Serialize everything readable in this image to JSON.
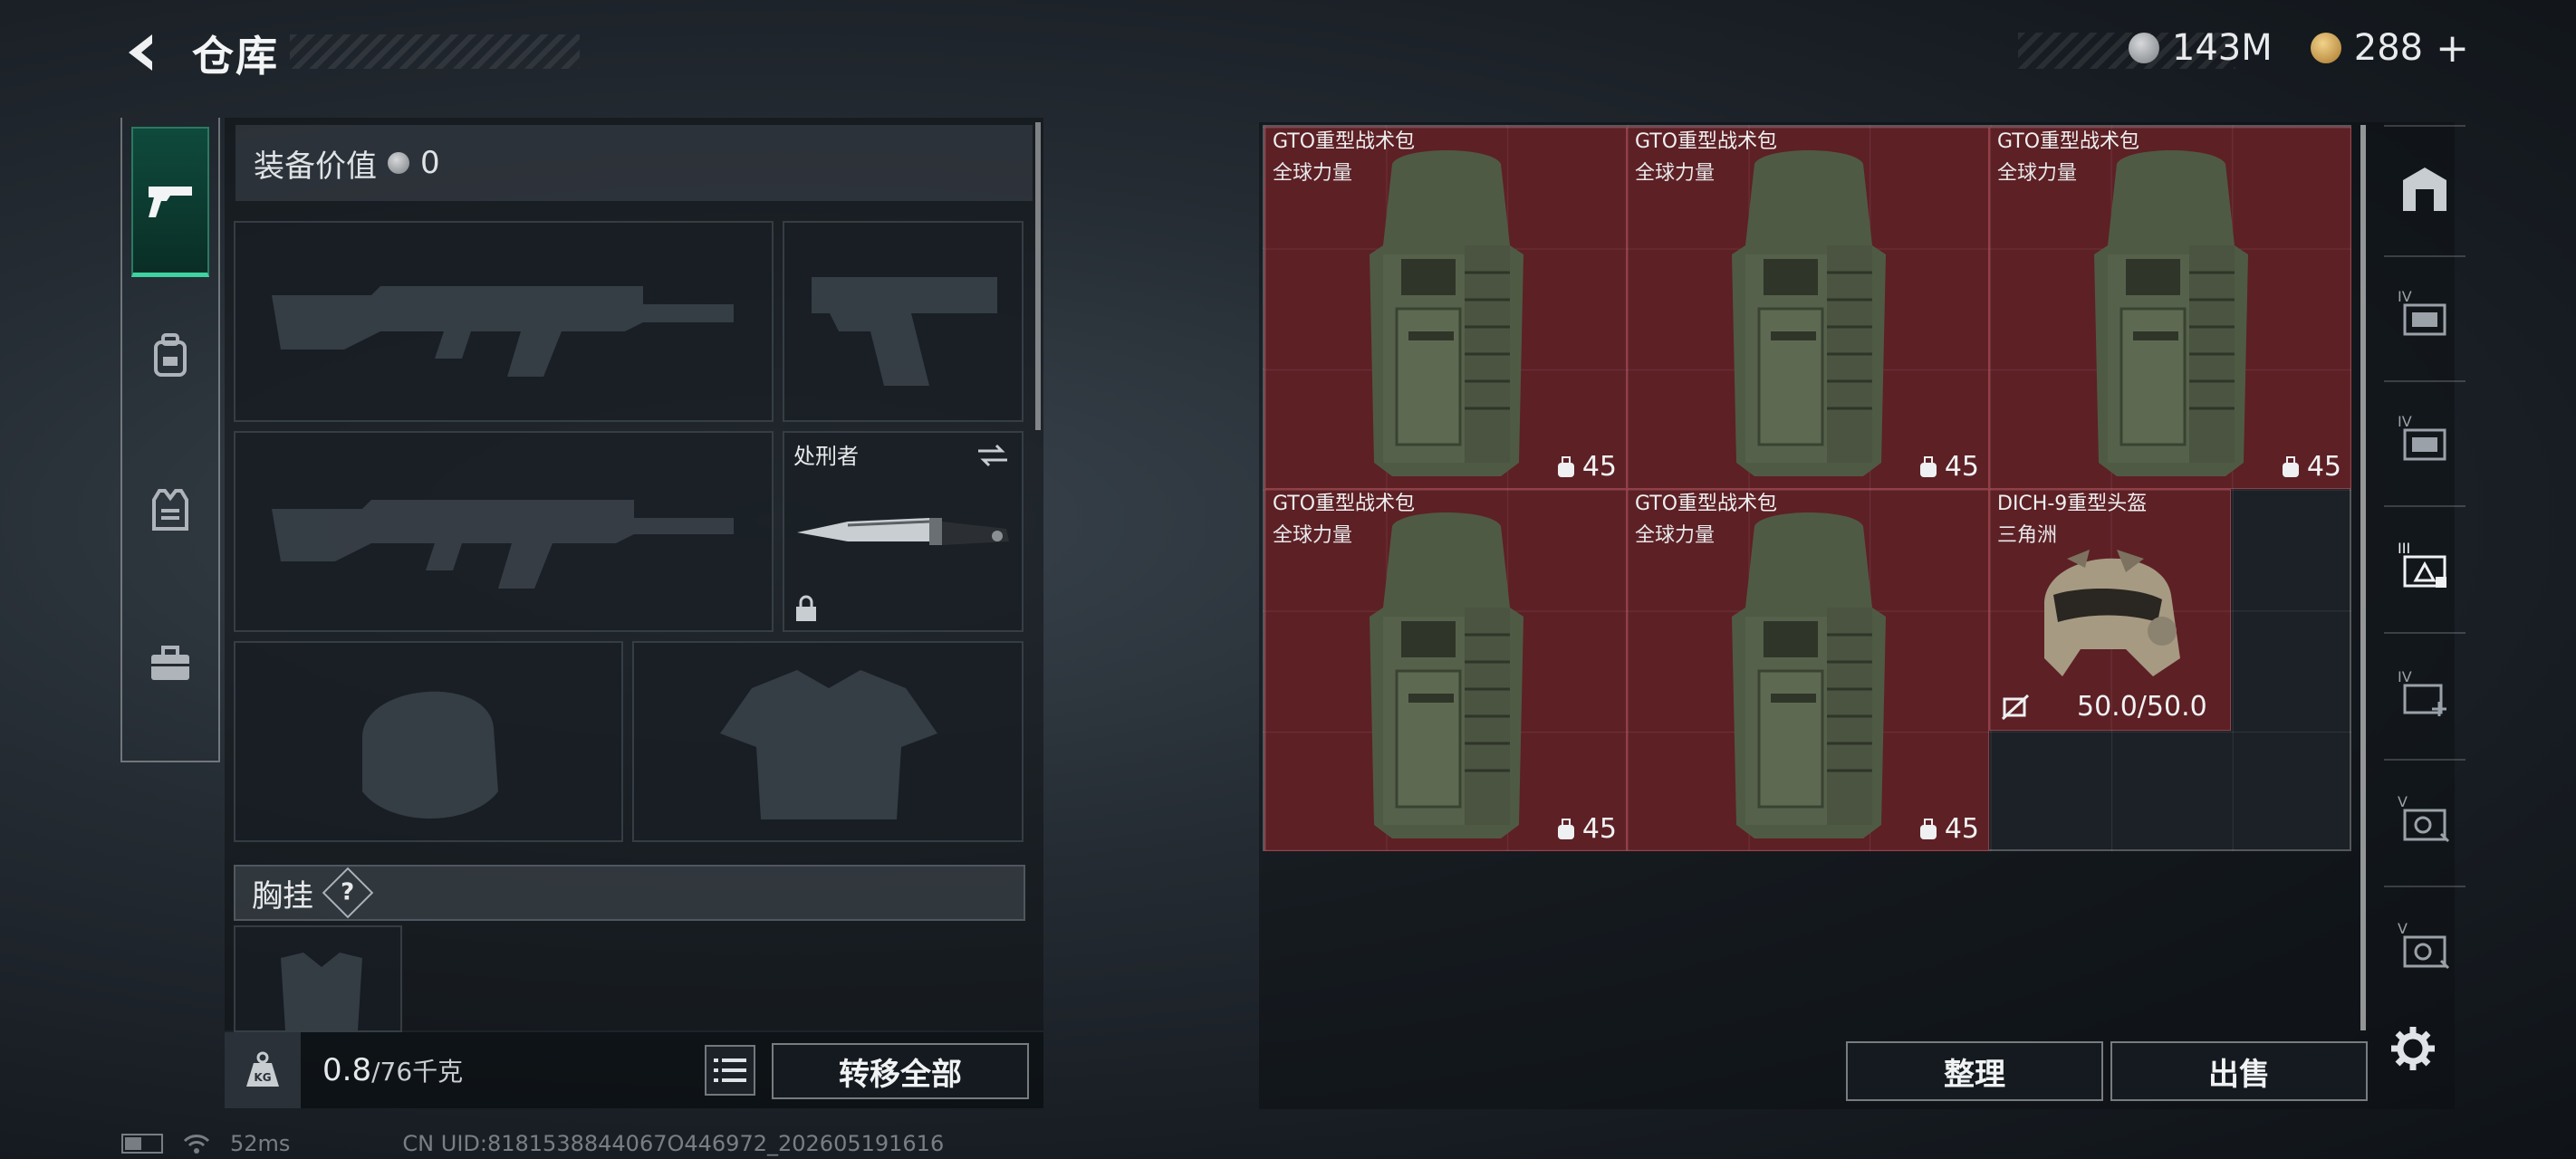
{
  "header": {
    "title": "仓库",
    "currency_silver": "143M",
    "currency_gold": "288",
    "add_label": "+"
  },
  "left_nav": {
    "items": [
      {
        "name": "weapons",
        "icon": "pistol-icon"
      },
      {
        "name": "gear",
        "icon": "backpack-icon"
      },
      {
        "name": "vest",
        "icon": "vest-icon"
      },
      {
        "name": "case",
        "icon": "briefcase-icon"
      }
    ]
  },
  "equipment": {
    "value_label": "装备价值",
    "value": "0",
    "melee_name": "处刑者",
    "chest_rig_label": "胸挂",
    "help_label": "?"
  },
  "bottom_left": {
    "weight_current": "0.8",
    "weight_max": "/76千克",
    "weight_icon_label": "KG",
    "transfer_all": "转移全部"
  },
  "storage": {
    "items": [
      {
        "name": "GTO重型战术包",
        "tag": "全球力量",
        "capacity": "45"
      },
      {
        "name": "GTO重型战术包",
        "tag": "全球力量",
        "capacity": "45"
      },
      {
        "name": "GTO重型战术包",
        "tag": "全球力量",
        "capacity": "45"
      },
      {
        "name": "GTO重型战术包",
        "tag": "全球力量",
        "capacity": "45"
      },
      {
        "name": "GTO重型战术包",
        "tag": "全球力量",
        "capacity": "45"
      }
    ],
    "helmet": {
      "name": "DICH-9重型头盔",
      "tag": "三角洲",
      "durability": "50.0/50.0"
    }
  },
  "tools": {
    "roman": [
      "IV",
      "IV",
      "III",
      "IV",
      "V",
      "V"
    ]
  },
  "actions": {
    "organize": "整理",
    "sell": "出售"
  },
  "status": {
    "ping": "52ms",
    "uid": "CN UID:8181538844067O446972_202605191616"
  }
}
